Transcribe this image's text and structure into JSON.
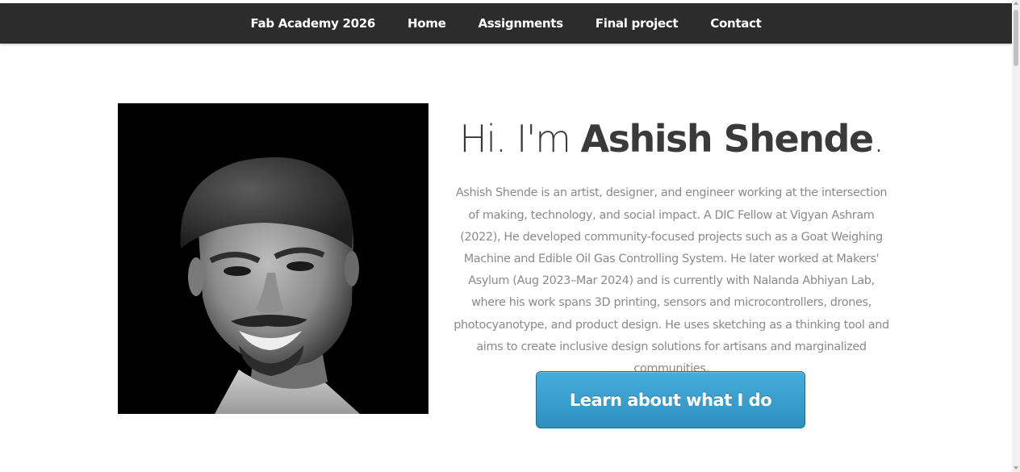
{
  "nav": {
    "items": [
      {
        "label": "Fab Academy 2026"
      },
      {
        "label": "Home"
      },
      {
        "label": "Assignments"
      },
      {
        "label": "Final project"
      },
      {
        "label": "Contact"
      }
    ]
  },
  "hero": {
    "greeting": "Hi. I'm ",
    "name": "Ashish Shende",
    "period": ".",
    "bio": "Ashish Shende is an artist, designer, and engineer working at the intersection of making, technology, and social impact. A DIC Fellow at Vigyan Ashram (2022), He developed community-focused projects such as a Goat Weighing Machine and Edible Oil Gas Controlling System. He later worked at Makers' Asylum (Aug 2023–Mar 2024) and is currently with Nalanda Abhiyan Lab, where his work spans 3D printing, sensors and microcontrollers, drones, photocyanotype, and product design. He uses sketching as a thinking tool and aims to create inclusive design solutions for artisans and marginalized communities.",
    "cta_label": "Learn about what I do"
  },
  "colors": {
    "navbar": "#2c2c2c",
    "heading": "#3a3a3a",
    "body_text": "#8a8a8a",
    "button": "#3a9fcf"
  }
}
